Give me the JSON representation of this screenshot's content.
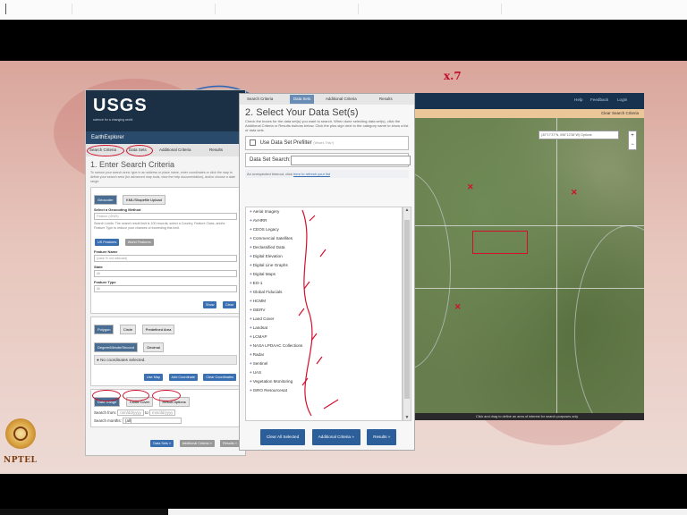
{
  "annotation_top": "x.7",
  "earthexplorer": {
    "logo": "USGS",
    "logo_tagline": "science for a changing world",
    "title": "EarthExplorer",
    "tabs": [
      "Search Criteria",
      "Data Sets",
      "Additional Criteria",
      "Results"
    ],
    "section_title": "1. Enter Search Criteria",
    "section_desc": "To narrow your search area: type in an address or place name, enter coordinates or click the map to define your search area (for advanced map tools, view the help documentation), and/or choose a date range.",
    "subtabs": [
      "Geocoder",
      "KML/Shapefile Upload"
    ],
    "geocoding_label": "Select a Geocoding Method",
    "geocoding_value": "Feature (GNIS)",
    "search_limits": "Search Limits: The search result limit is 100 records; select a Country, Feature Class, and/or Feature Type to reduce your chances of exceeding this limit.",
    "feature_buttons": [
      "US Features",
      "World Features"
    ],
    "feature_name_label": "Feature Name",
    "feature_name_placeholder": "(case % not wildcard)",
    "state_label": "State",
    "state_value": "All",
    "feature_type_label": "Feature Type",
    "feature_type_value": "All",
    "show_button": "Show",
    "clear_button": "Clear",
    "polygon_tabs": [
      "Polygon",
      "Circle",
      "Predefined Area"
    ],
    "coord_tabs": [
      "Degree/Minute/Second",
      "Decimal"
    ],
    "no_coords": "No coordinates selected.",
    "map_buttons": [
      "Use Map",
      "Add Coordinate",
      "Clear Coordinates"
    ],
    "date_tabs": [
      "Date Range",
      "Cloud Cover",
      "Result Options"
    ],
    "search_from_label": "Search from:",
    "search_from_value": "mm/dd/yyyy",
    "to_label": "to",
    "to_value": "mm/dd/yyyy",
    "search_months_label": "Search months:",
    "search_months_value": "(all)",
    "footer_buttons": [
      "Data Sets »",
      "Additional Criteria »",
      "Results »"
    ]
  },
  "datasets": {
    "tabs": [
      "Search Criteria",
      "Data Sets",
      "Additional Criteria",
      "Results"
    ],
    "title": "2. Select Your Data Set(s)",
    "desc": "Check the boxes for the data set(s) you want to search. When done selecting data set(s), click the Additional Criteria or Results buttons below. Click the plus sign next to the category name to show a list of data sets.",
    "prefilter_label": "Use Data Set Prefilter",
    "prefilter_hint": "(What's This?)",
    "search_label": "Data Set Search:",
    "note_text": "An unexpected timeout, click",
    "note_link": "here to refresh your list",
    "items": [
      "Aerial Imagery",
      "AVHRR",
      "CEOS Legacy",
      "Commercial Satellites",
      "Declassified Data",
      "Digital Elevation",
      "Digital Line Graphs",
      "Digital Maps",
      "EO-1",
      "Global Fiducials",
      "HCMM",
      "ISERV",
      "Land Cover",
      "Landsat",
      "LCMAP",
      "NASA LPDAAC Collections",
      "Radar",
      "Sentinel",
      "UAS",
      "Vegetation Monitoring",
      "ISRO Resourcesat"
    ],
    "footer_buttons": [
      "Clear All Selected",
      "Additional Criteria »",
      "Results »"
    ]
  },
  "map": {
    "nav": [
      "Help",
      "Feedback",
      "Login"
    ],
    "clear_label": "Clear Search Criteria",
    "search_text": "(30°17'37\"N, 096°12'38\"W) Options",
    "status": "Click and drag to define an area of interest for search purposes only"
  },
  "nptel": {
    "label": "NPTEL"
  }
}
